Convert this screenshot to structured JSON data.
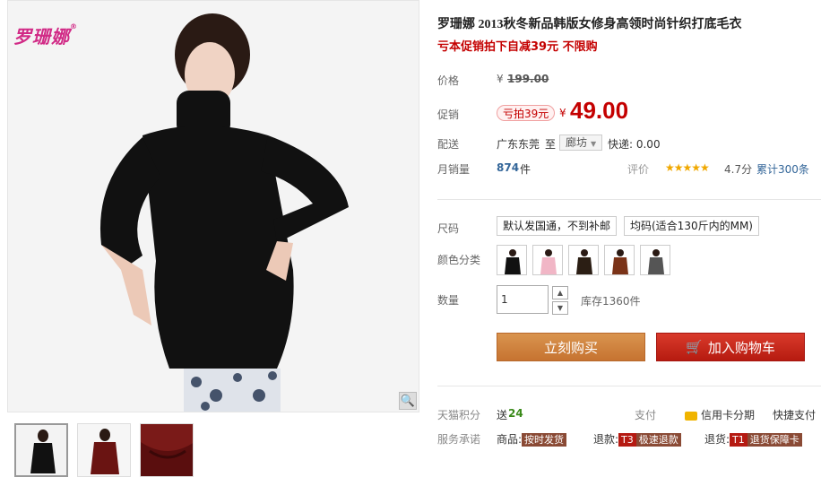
{
  "brand": {
    "logo_text": "罗珊娜",
    "logo_mark": "®"
  },
  "gallery": {
    "zoom_glyph": "🔍",
    "thumb_count": 3,
    "active_thumb": 1
  },
  "product": {
    "title": "罗珊娜 2013秋冬新品韩版女修身高领时尚针织打底毛衣",
    "subtitle": "亏本促销拍下自减39元 不限购"
  },
  "price": {
    "label": "价格",
    "currency": "¥",
    "original": "199.00"
  },
  "promo": {
    "label": "促销",
    "tag": "亏拍39元",
    "currency": "¥",
    "price": "49.00"
  },
  "shipping": {
    "label": "配送",
    "from": "广东东莞",
    "to_word": "至",
    "dest": "廊坊",
    "fee": "快递: 0.00"
  },
  "sales": {
    "label": "月销量",
    "count": "874",
    "unit": "件",
    "rating_label": "评价",
    "stars": "★★★★★",
    "score": "4.7分",
    "total": "累计300条"
  },
  "size": {
    "label": "尺码",
    "options": [
      "默认发国通，不到补邮",
      "均码(适合130斤内的MM)"
    ]
  },
  "color": {
    "label": "颜色分类",
    "swatches": [
      "black",
      "pink",
      "dark-brown",
      "rust",
      "grey"
    ]
  },
  "quantity": {
    "label": "数量",
    "value": "1",
    "stock": "库存1360件"
  },
  "actions": {
    "buy_label": "立刻购买",
    "cart_label": "加入购物车",
    "cart_icon": "🛒"
  },
  "extras": {
    "points_label": "天猫积分",
    "points_prefix": "送",
    "points_value": "24",
    "pay_label": "支付",
    "credit_label": "信用卡分期",
    "fast_pay": "快捷支付",
    "promise_label": "服务承诺",
    "promise_items": [
      {
        "prefix": "商品:",
        "badge": "按时发货",
        "color": "brown"
      },
      {
        "prefix": "退款:",
        "badge_code": "T3",
        "badge": "极速退款",
        "color": "brown"
      },
      {
        "prefix": "退货:",
        "badge_code": "T1",
        "badge": "退货保障卡",
        "color": "brown"
      }
    ]
  },
  "colors": {
    "accent_red": "#c40000",
    "buy_orange": "#c67331",
    "cart_red": "#b61b10",
    "sweater": "#111111"
  }
}
